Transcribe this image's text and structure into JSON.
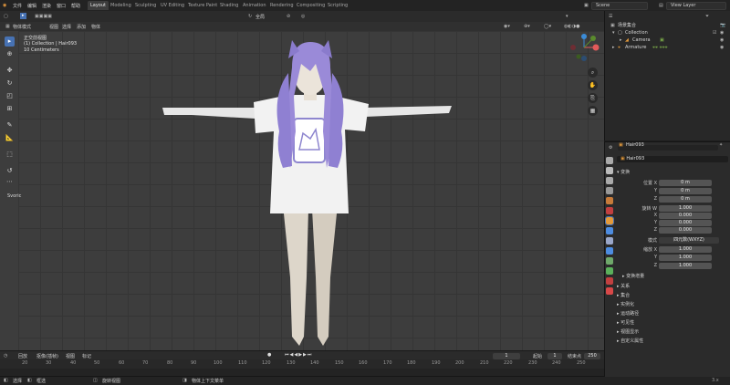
{
  "topbar": {
    "menus": [
      "文件",
      "编辑",
      "渲染",
      "窗口",
      "帮助"
    ],
    "workspaces": [
      "Layout",
      "Modeling",
      "Sculpting",
      "UV Editing",
      "Texture Paint",
      "Shading",
      "Animation",
      "Rendering",
      "Compositing",
      "Scripting"
    ],
    "active_workspace": "Layout",
    "scene": "Scene",
    "view_layer": "View Layer"
  },
  "viewport_header": {
    "mode": "物体模式",
    "menus": [
      "视图",
      "选择",
      "添加",
      "物体"
    ],
    "transform": "全局"
  },
  "viewport": {
    "overlay_line1": "正交前视图",
    "overlay_line2": "(1) Collection | Hair093",
    "overlay_line3": "10 Centimeters",
    "tool_label": "Svoric"
  },
  "timeline": {
    "menus": [
      "回放",
      "抠像(插帧)",
      "视图",
      "标记"
    ],
    "current_frame": "1",
    "start_label": "起始",
    "start": "1",
    "end_label": "结束点",
    "end": "250",
    "ticks": [
      "20",
      "30",
      "40",
      "50",
      "60",
      "70",
      "80",
      "90",
      "100",
      "110",
      "120",
      "130",
      "140",
      "150",
      "160",
      "170",
      "180",
      "190",
      "200",
      "210",
      "220",
      "230",
      "240",
      "250"
    ]
  },
  "statusbar": {
    "select": "选择",
    "box": "框选",
    "rotate": "旋转视图",
    "context": "物体上下文菜单",
    "version": "3.x"
  },
  "outliner": {
    "title": "场景集合",
    "items": [
      {
        "label": "Collection"
      },
      {
        "label": "Camera"
      },
      {
        "label": "Armature"
      }
    ]
  },
  "properties": {
    "object_name": "Hair093",
    "data_name": "Hair093",
    "transform_section": "变换",
    "location_label": "位置 X",
    "rotation_label": "旋转 W",
    "mode_label": "模式",
    "mode_value": "四元数(WXYZ)",
    "scale_label": "缩放 X",
    "axis_y": "Y",
    "axis_z": "Z",
    "axis_x": "X",
    "location": [
      "0 m",
      "0 m",
      "0 m"
    ],
    "rotation": [
      "1.000",
      "0.000",
      "0.000",
      "0.000"
    ],
    "scale": [
      "1.000",
      "1.000",
      "1.000"
    ],
    "subsections": [
      "变换增量",
      "关系",
      "集合",
      "实例化",
      "运动路径",
      "可见性",
      "视图显示",
      "自定义属性"
    ]
  },
  "colors": {
    "accent": "#4772b3",
    "viewport_bg": "#3d3d3d",
    "grid": "#353535",
    "hair": "#9a8ad8",
    "shirt": "#f2f2f2",
    "skin": "#e0d8cc"
  }
}
